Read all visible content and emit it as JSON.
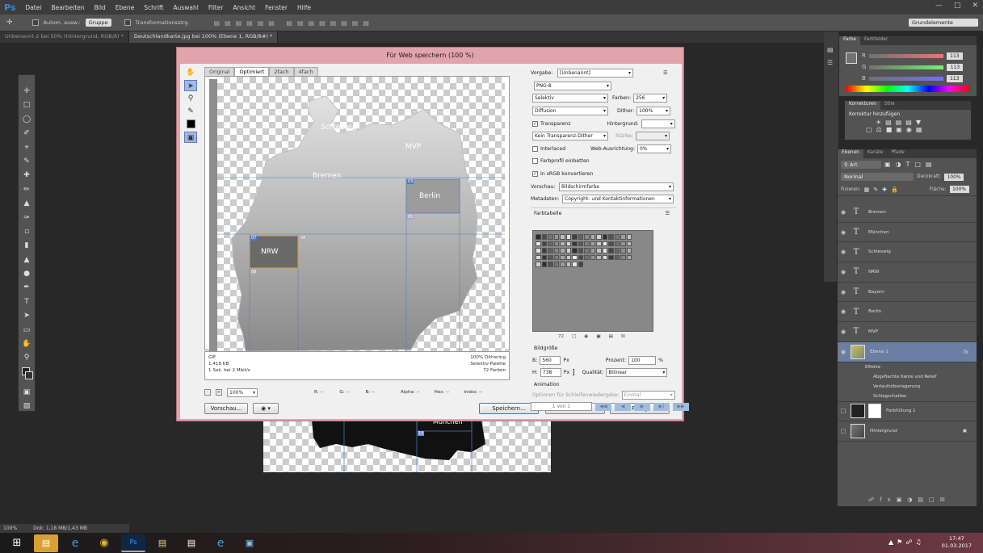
{
  "menubar": {
    "logo": "Ps",
    "items": [
      "Datei",
      "Bearbeiten",
      "Bild",
      "Ebene",
      "Schrift",
      "Auswahl",
      "Filter",
      "Ansicht",
      "Fenster",
      "Hilfe"
    ]
  },
  "options": {
    "auto_select": "Autom. ausw.:",
    "auto_select_value": "Gruppe",
    "transform": "Transformationsstrg.",
    "workspace": "Grundelemente"
  },
  "doc_tabs": [
    {
      "label": "Unbenannt-2 bei 50% (Hintergrund, RGB/8) *"
    },
    {
      "label": "Deutschlandkarte.jpg bei 100% (Ebene 1, RGB/8#) *"
    }
  ],
  "status": {
    "zoom": "100%",
    "doc": "Dok: 1,18 MB/1,43 MB"
  },
  "dialog": {
    "title": "Für Web speichern (100 %)",
    "view_tabs": [
      "Original",
      "Optimiert",
      "2fach",
      "4fach"
    ],
    "map_labels": {
      "schleswig": "Schleswig",
      "mvp": "MVP",
      "bremen": "Bremen",
      "berlin": "Berlin",
      "nrw": "NRW"
    },
    "slices": {
      "s03": "03",
      "s05": "05",
      "s07": "07",
      "s08": "08",
      "s09": "09"
    },
    "info_left": [
      "GIF",
      "1,418 KB",
      "1 Sek. bei 2 Mbit/s"
    ],
    "info_right": [
      "100% Dithering",
      "Selektiv-Palette",
      "72 Farben"
    ],
    "zoom_value": "100%",
    "readouts": {
      "r": "R: --",
      "g": "G: --",
      "b": "B: --",
      "alpha": "Alpha: --",
      "hex": "Hex: --",
      "index": "Index: --"
    },
    "buttons": {
      "preview": "Vorschau...",
      "save": "Speichern...",
      "cancel": "Abbrechen",
      "done": "Fertig"
    },
    "settings": {
      "preset_label": "Vorgabe:",
      "preset_value": "[Unbenannt]",
      "format": "PNG-8",
      "reduction": "Selektiv",
      "colors_label": "Farben:",
      "colors_value": "256",
      "dither_algo": "Diffusion",
      "dither_label": "Dither:",
      "dither_value": "100%",
      "transparency": "Transparenz",
      "matte_label": "Hintergrund:",
      "trans_dither": "Kein Transparenz-Dither",
      "amount_label": "Stärke:",
      "interlaced": "Interlaced",
      "websnap_label": "Web-Ausrichtung:",
      "websnap_value": "0%",
      "embed_profile": "Farbprofil einbetten",
      "srgb": "In sRGB konvertieren",
      "preview_label": "Vorschau:",
      "preview_value": "Bildschirmfarbe",
      "metadata_label": "Metadaten:",
      "metadata_value": "Copyright- und Kontaktinformationen",
      "color_table": "Farbtabelle",
      "color_count": "72",
      "image_size": "Bildgröße",
      "w_label": "B:",
      "w_value": "560",
      "h_label": "H:",
      "h_value": "738",
      "px": "Px",
      "percent_label": "Prozent:",
      "percent_value": "100",
      "percent_unit": "%",
      "quality_label": "Qualität:",
      "quality_value": "Bilinear",
      "animation": "Animation",
      "loop_label": "Optionen für Schleifenwiedergabe:",
      "loop_value": "Einmal",
      "frame": "1 von 1"
    }
  },
  "color_panel": {
    "tabs": [
      "Farbe",
      "Farbfelder"
    ],
    "r": "R",
    "g": "G",
    "b": "B",
    "r_val": "113",
    "g_val": "113",
    "b_val": "113"
  },
  "corrections": {
    "tabs": [
      "Korrekturen",
      "Stile"
    ],
    "title": "Korrektur hinzufügen"
  },
  "layers_panel": {
    "tabs": [
      "Ebenen",
      "Kanäle",
      "Pfade"
    ],
    "kind": "Art",
    "blend": "Normal",
    "opacity_label": "Deckkraft:",
    "opacity": "100%",
    "lock_label": "Fixieren:",
    "fill_label": "Fläche:",
    "fill": "100%",
    "text_layers": [
      "Bremen",
      "München",
      "Schleswig",
      "NRW",
      "Bayern",
      "Berlin",
      "MVP"
    ],
    "ebene1": "Ebene 1",
    "effects": "Effekte",
    "effect_items": [
      "Abgeflachte Kante und Relief",
      "Verlaufsüberlagerung",
      "Schlagschatten"
    ],
    "fill_layer": "Farbfüllung 1",
    "background": "Hintergrund"
  },
  "bg_canvas": {
    "label": "München",
    "slice": "13"
  },
  "clock": {
    "time": "17:47",
    "date": "01.03.2017"
  },
  "colors": {
    "accent": "#2d8ceb",
    "dialog_border": "#e1a4ad",
    "panel": "#535353"
  }
}
